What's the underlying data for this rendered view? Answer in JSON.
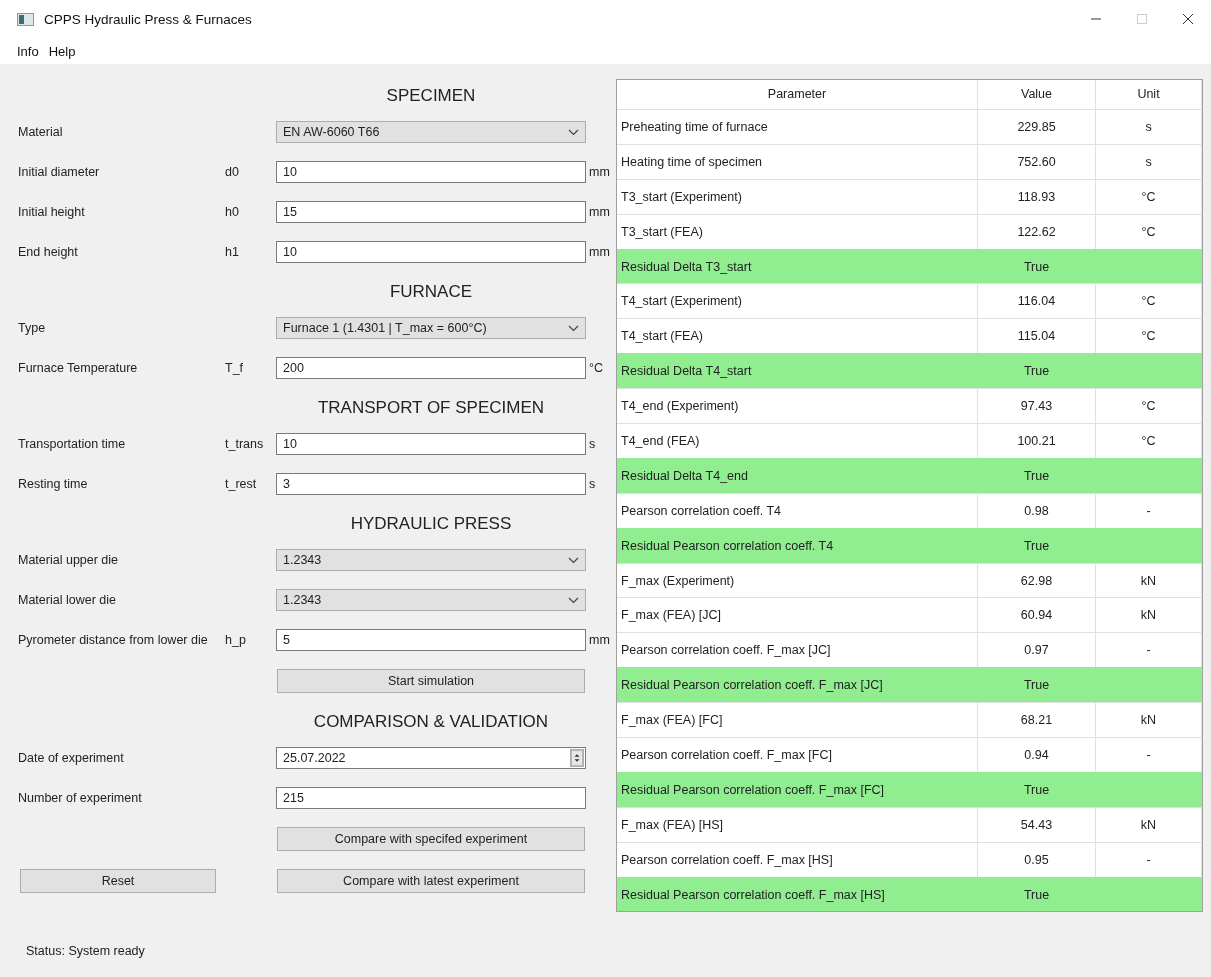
{
  "window": {
    "title": "CPPS Hydraulic Press & Furnaces"
  },
  "menu": [
    "Info",
    "Help"
  ],
  "sections": [
    {
      "heading": "SPECIMEN",
      "items": [
        {
          "kind": "dropdown",
          "label": "Material",
          "value": "EN AW-6060 T66"
        },
        {
          "kind": "text",
          "label": "Initial diameter",
          "symbol": "d0",
          "value": "10",
          "unit": "mm"
        },
        {
          "kind": "text",
          "label": "Initial height",
          "symbol": "h0",
          "value": "15",
          "unit": "mm"
        },
        {
          "kind": "text",
          "label": "End height",
          "symbol": "h1",
          "value": "10",
          "unit": "mm"
        }
      ]
    },
    {
      "heading": "FURNACE",
      "items": [
        {
          "kind": "dropdown",
          "label": "Type",
          "value": "Furnace 1 (1.4301 | T_max = 600°C)"
        },
        {
          "kind": "text",
          "label": "Furnace Temperature",
          "symbol": "T_f",
          "value": "200",
          "unit": "°C"
        }
      ]
    },
    {
      "heading": "TRANSPORT OF SPECIMEN",
      "items": [
        {
          "kind": "text",
          "label": "Transportation time",
          "symbol": "t_trans",
          "value": "10",
          "unit": "s"
        },
        {
          "kind": "text",
          "label": "Resting time",
          "symbol": "t_rest",
          "value": "3",
          "unit": "s"
        }
      ]
    },
    {
      "heading": "HYDRAULIC PRESS",
      "items": [
        {
          "kind": "dropdown",
          "label": "Material upper die",
          "value": "1.2343"
        },
        {
          "kind": "dropdown",
          "label": "Material lower die",
          "value": "1.2343"
        },
        {
          "kind": "text",
          "label": "Pyrometer distance from lower die",
          "symbol": "h_p",
          "value": "5",
          "unit": "mm"
        },
        {
          "kind": "button",
          "label": "Start simulation"
        }
      ]
    },
    {
      "heading": "COMPARISON & VALIDATION",
      "items": [
        {
          "kind": "date",
          "label": "Date of experiment",
          "value": "25.07.2022"
        },
        {
          "kind": "text",
          "label": "Number of experiment",
          "value": "215"
        },
        {
          "kind": "button",
          "label": "Compare with specifed experiment"
        }
      ]
    }
  ],
  "bottom_row": {
    "left_button": "Reset",
    "right_button": "Compare with latest experiment"
  },
  "table": {
    "columns": [
      "Parameter",
      "Value",
      "Unit"
    ],
    "rows": [
      {
        "parameter": "Preheating time of furnace",
        "value": "229.85",
        "unit": "s",
        "highlighted": false
      },
      {
        "parameter": "Heating time of specimen",
        "value": "752.60",
        "unit": "s",
        "highlighted": false
      },
      {
        "parameter": "T3_start (Experiment)",
        "value": "118.93",
        "unit": "°C",
        "highlighted": false
      },
      {
        "parameter": "T3_start (FEA)",
        "value": "122.62",
        "unit": "°C",
        "highlighted": false
      },
      {
        "parameter": "Residual Delta T3_start",
        "value": "True",
        "highlighted": true
      },
      {
        "parameter": "T4_start (Experiment)",
        "value": "116.04",
        "unit": "°C",
        "highlighted": false
      },
      {
        "parameter": "T4_start (FEA)",
        "value": "115.04",
        "unit": "°C",
        "highlighted": false
      },
      {
        "parameter": "Residual Delta T4_start",
        "value": "True",
        "highlighted": true
      },
      {
        "parameter": "T4_end (Experiment)",
        "value": "97.43",
        "unit": "°C",
        "highlighted": false
      },
      {
        "parameter": "T4_end (FEA)",
        "value": "100.21",
        "unit": "°C",
        "highlighted": false
      },
      {
        "parameter": "Residual Delta T4_end",
        "value": "True",
        "highlighted": true
      },
      {
        "parameter": "Pearson correlation coeff. T4",
        "value": "0.98",
        "unit": "-",
        "highlighted": false
      },
      {
        "parameter": "Residual Pearson correlation coeff. T4",
        "value": "True",
        "highlighted": true
      },
      {
        "parameter": "F_max (Experiment)",
        "value": "62.98",
        "unit": "kN",
        "highlighted": false
      },
      {
        "parameter": "F_max (FEA) [JC]",
        "value": "60.94",
        "unit": "kN",
        "highlighted": false
      },
      {
        "parameter": "Pearson correlation coeff. F_max [JC]",
        "value": "0.97",
        "unit": "-",
        "highlighted": false
      },
      {
        "parameter": "Residual Pearson correlation coeff. F_max [JC]",
        "value": "True",
        "highlighted": true
      },
      {
        "parameter": "F_max (FEA) [FC]",
        "value": "68.21",
        "unit": "kN",
        "highlighted": false
      },
      {
        "parameter": "Pearson correlation coeff. F_max [FC]",
        "value": "0.94",
        "unit": "-",
        "highlighted": false
      },
      {
        "parameter": "Residual Pearson correlation coeff. F_max [FC]",
        "value": "True",
        "highlighted": true
      },
      {
        "parameter": "F_max (FEA) [HS]",
        "value": "54.43",
        "unit": "kN",
        "highlighted": false
      },
      {
        "parameter": "Pearson correlation coeff. F_max [HS]",
        "value": "0.95",
        "unit": "-",
        "highlighted": false
      },
      {
        "parameter": "Residual Pearson correlation coeff. F_max [HS]",
        "value": "True",
        "highlighted": true
      }
    ]
  },
  "status_bar": "Status: System ready"
}
